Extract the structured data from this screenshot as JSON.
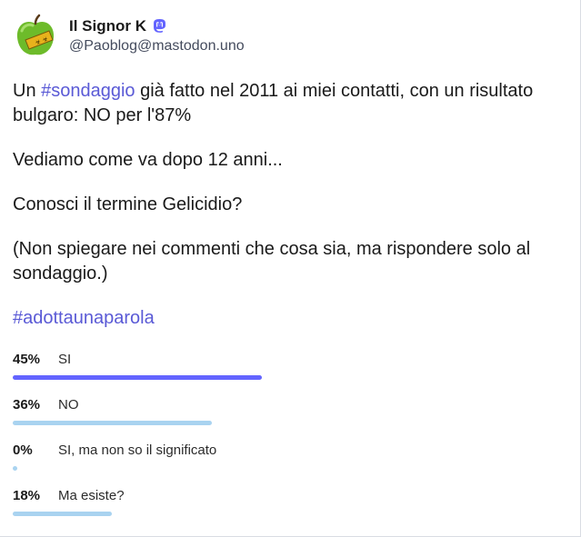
{
  "post": {
    "display_name": "Il Signor K",
    "handle": "@Paoblog@mastodon.uno",
    "icons": {
      "avatar": "green-apple-avatar",
      "platform": "mastodon-icon"
    },
    "paragraphs": [
      [
        {
          "text": "Un ",
          "hashtag": false
        },
        {
          "text": "#sondaggio",
          "hashtag": true
        },
        {
          "text": " già fatto nel 2011 ai miei contatti, con un risultato bulgaro: NO per l'87%",
          "hashtag": false
        }
      ],
      [
        {
          "text": "Vediamo come va dopo 12 anni...",
          "hashtag": false
        }
      ],
      [
        {
          "text": "Conosci il termine Gelicidio?",
          "hashtag": false
        }
      ],
      [
        {
          "text": "(Non spiegare nei commenti che cosa sia, ma rispondere solo al sondaggio.)",
          "hashtag": false
        }
      ],
      [
        {
          "text": "#adottaunaparola",
          "hashtag": true
        }
      ]
    ]
  },
  "poll": {
    "options": [
      {
        "percent_label": "45%",
        "label": "SI",
        "fraction": 0.45,
        "leading": true
      },
      {
        "percent_label": "36%",
        "label": "NO",
        "fraction": 0.36,
        "leading": false
      },
      {
        "percent_label": "0%",
        "label": "SI, ma non so il significato",
        "fraction": 0.0,
        "leading": false
      },
      {
        "percent_label": "18%",
        "label": "Ma esiste?",
        "fraction": 0.18,
        "leading": false
      }
    ]
  },
  "colors": {
    "hashtag": "#5a5ad6",
    "bar_leading": "#6364ff",
    "bar_other": "#a9d3f0",
    "mastodon": "#6364ff"
  }
}
